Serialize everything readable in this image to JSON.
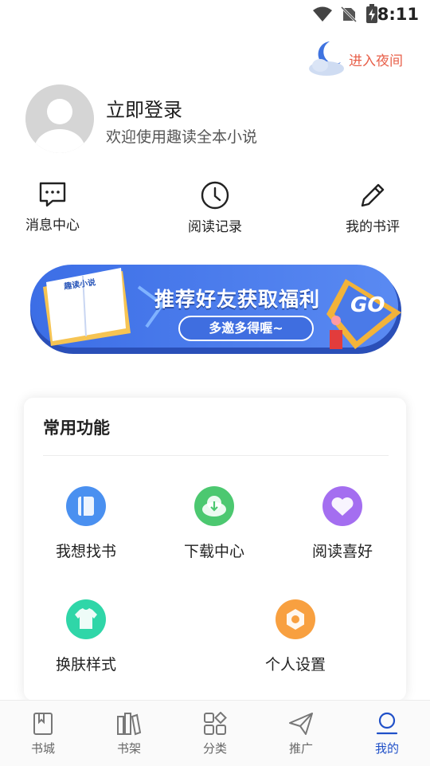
{
  "status_bar": {
    "time": "8:11"
  },
  "night_mode": {
    "label": "进入夜间"
  },
  "profile": {
    "title": "立即登录",
    "subtitle": "欢迎使用趣读全本小说"
  },
  "quick_actions": [
    {
      "label": "消息中心",
      "icon": "message-icon"
    },
    {
      "label": "阅读记录",
      "icon": "clock-icon"
    },
    {
      "label": "我的书评",
      "icon": "pencil-icon"
    }
  ],
  "banner": {
    "book_title": "趣读小说",
    "headline": "推荐好友获取福利",
    "button": "多邀多得喔~",
    "go": "GO"
  },
  "common_functions": {
    "title": "常用功能",
    "items": [
      {
        "label": "我想找书",
        "icon": "book-icon",
        "color": "#4a90f0"
      },
      {
        "label": "下载中心",
        "icon": "download-cloud-icon",
        "color": "#4cc870"
      },
      {
        "label": "阅读喜好",
        "icon": "heart-icon",
        "color": "#a46ef0"
      },
      {
        "label": "换肤样式",
        "icon": "shirt-icon",
        "color": "#2fd6a8"
      },
      {
        "label": "个人设置",
        "icon": "settings-nut-icon",
        "color": "#f8a040"
      }
    ]
  },
  "bottom_nav": {
    "active": "我的",
    "items": [
      {
        "label": "书城",
        "icon": "book-icon"
      },
      {
        "label": "书架",
        "icon": "bookshelf-icon"
      },
      {
        "label": "分类",
        "icon": "category-icon"
      },
      {
        "label": "推广",
        "icon": "paper-plane-icon"
      },
      {
        "label": "我的",
        "icon": "person-icon"
      }
    ]
  }
}
